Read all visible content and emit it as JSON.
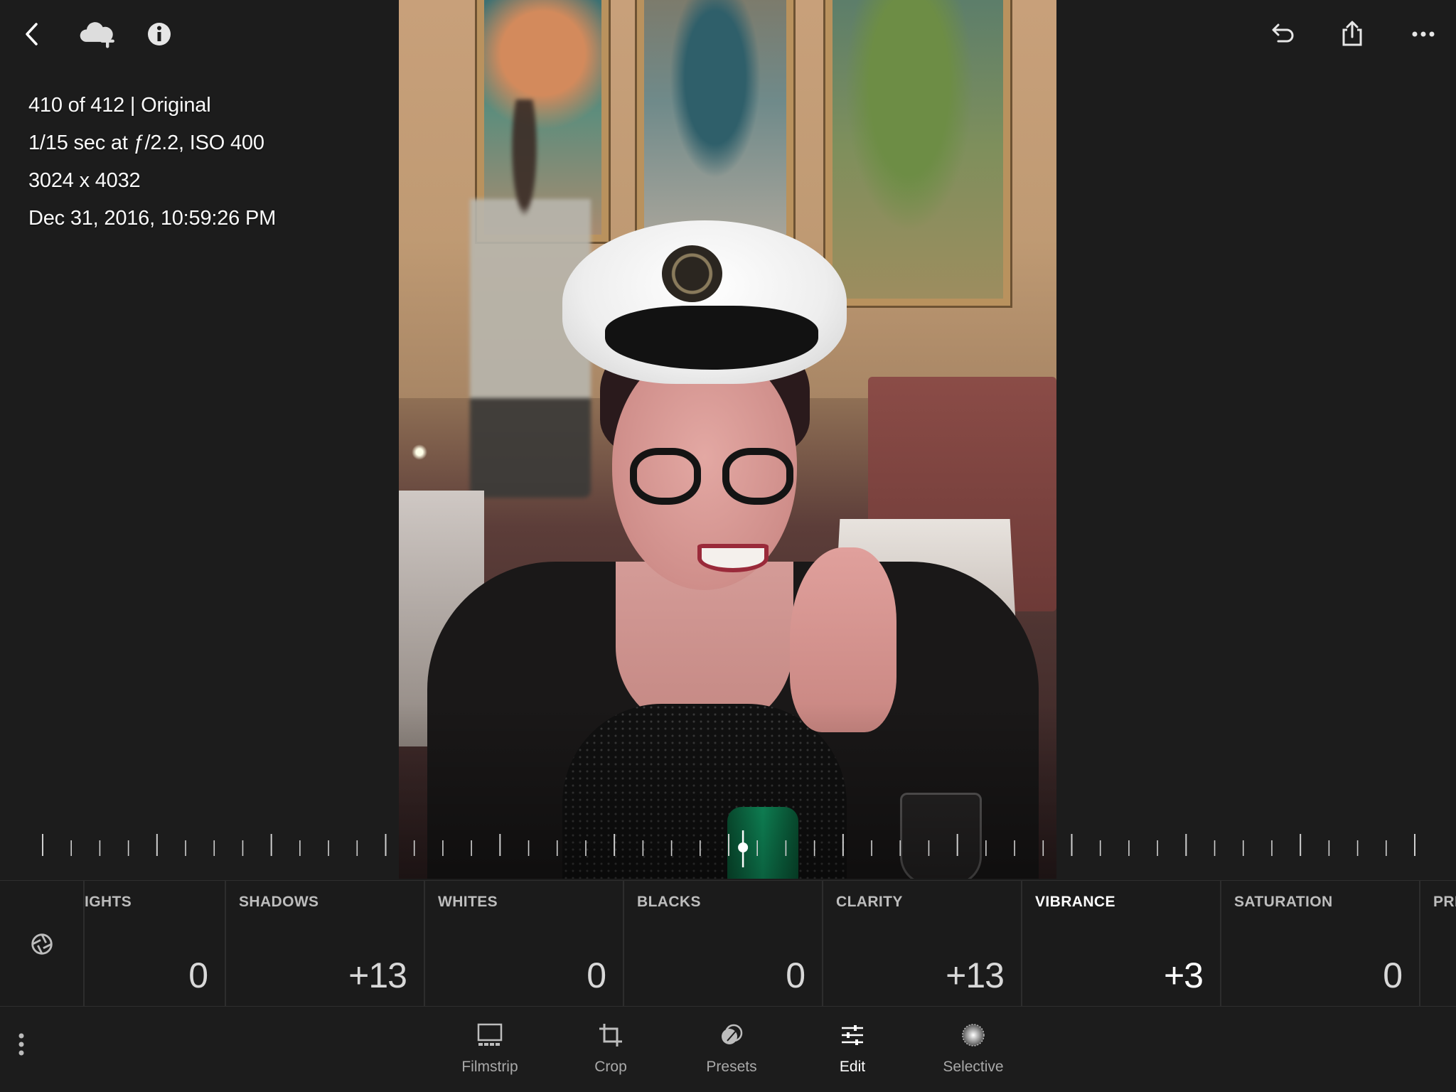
{
  "top_bar": {
    "left_icons": [
      "back-chevron-icon",
      "cloud-add-icon",
      "info-icon"
    ],
    "right_icons": [
      "undo-icon",
      "share-icon",
      "more-horizontal-icon"
    ]
  },
  "photo_info": {
    "position": "410 of 412 | Original",
    "exposure": "1/15 sec at ƒ/2.2, ISO 400",
    "dimensions": "3024 x 4032",
    "datetime": "Dec 31, 2016, 10:59:26 PM"
  },
  "slider": {
    "active_adjustment": "VIBRANCE",
    "value": 3,
    "min": -100,
    "max": 100
  },
  "adjustments": [
    {
      "name": "IGHTS",
      "value": "0"
    },
    {
      "name": "SHADOWS",
      "value": "+13"
    },
    {
      "name": "WHITES",
      "value": "0"
    },
    {
      "name": "BLACKS",
      "value": "0"
    },
    {
      "name": "CLARITY",
      "value": "+13"
    },
    {
      "name": "VIBRANCE",
      "value": "+3"
    },
    {
      "name": "SATURATION",
      "value": "0"
    },
    {
      "name": "PRI",
      "value": ""
    }
  ],
  "toolbar": {
    "items": [
      {
        "label": "Filmstrip",
        "icon": "filmstrip-icon"
      },
      {
        "label": "Crop",
        "icon": "crop-icon"
      },
      {
        "label": "Presets",
        "icon": "presets-icon"
      },
      {
        "label": "Edit",
        "icon": "edit-sliders-icon",
        "active": true
      },
      {
        "label": "Selective",
        "icon": "selective-icon"
      }
    ]
  },
  "colors": {
    "background": "#1c1c1c",
    "text_primary": "#ffffff",
    "text_secondary": "#a9a9a9",
    "divider": "#2d2d2d"
  }
}
